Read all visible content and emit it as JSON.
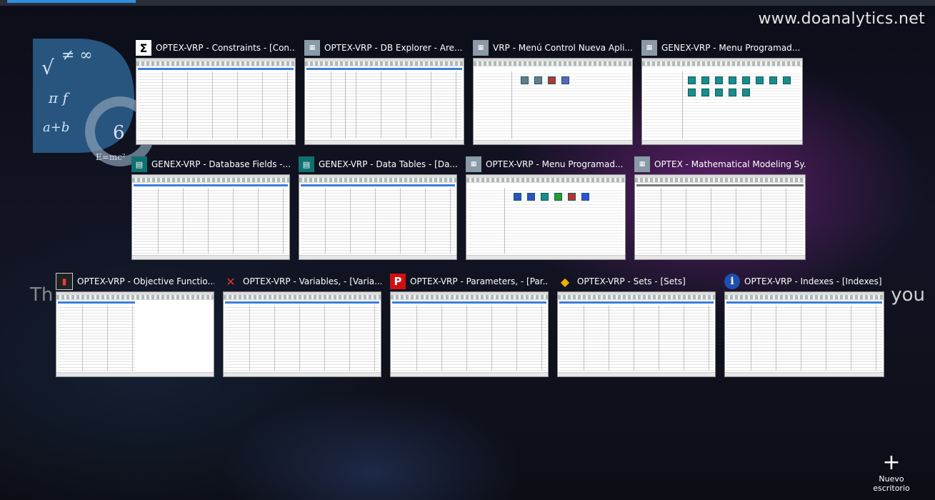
{
  "watermark": {
    "site": "www.doanalytics.net"
  },
  "banner": {
    "left_text": "Th",
    "right_text": "you"
  },
  "new_desktop": {
    "icon": "plus-icon",
    "label": "Nuevo escritorio"
  },
  "windows": [
    {
      "title": "OPTEX-VRP - Constraints - [Con...",
      "icon": "sigma-icon"
    },
    {
      "title": "OPTEX-VRP - DB Explorer - Are...",
      "icon": "optex-app-icon"
    },
    {
      "title": "VRP - Menú Control Nueva Apli...",
      "icon": "optex-app-icon"
    },
    {
      "title": "GENEX-VRP - Menu Programad...",
      "icon": "optex-app-icon"
    },
    {
      "title": "GENEX-VRP - Database Fields -...",
      "icon": "database-fields-icon"
    },
    {
      "title": "GENEX-VRP - Data Tables - [Da...",
      "icon": "data-tables-icon"
    },
    {
      "title": "OPTEX-VRP - Menu Programad...",
      "icon": "optex-app-icon"
    },
    {
      "title": "OPTEX - Mathematical Modeling Sy...",
      "icon": "optex-app-icon"
    },
    {
      "title": "OPTEX-VRP - Objective Functio...",
      "icon": "objective-function-icon"
    },
    {
      "title": "OPTEX-VRP - Variables, - [Varia...",
      "icon": "variables-icon"
    },
    {
      "title": "OPTEX-VRP - Parameters, - [Par...",
      "icon": "parameters-icon"
    },
    {
      "title": "OPTEX-VRP - Sets - [Sets]",
      "icon": "sets-icon"
    },
    {
      "title": "OPTEX-VRP - Indexes - [Indexes]",
      "icon": "info-icon"
    }
  ]
}
